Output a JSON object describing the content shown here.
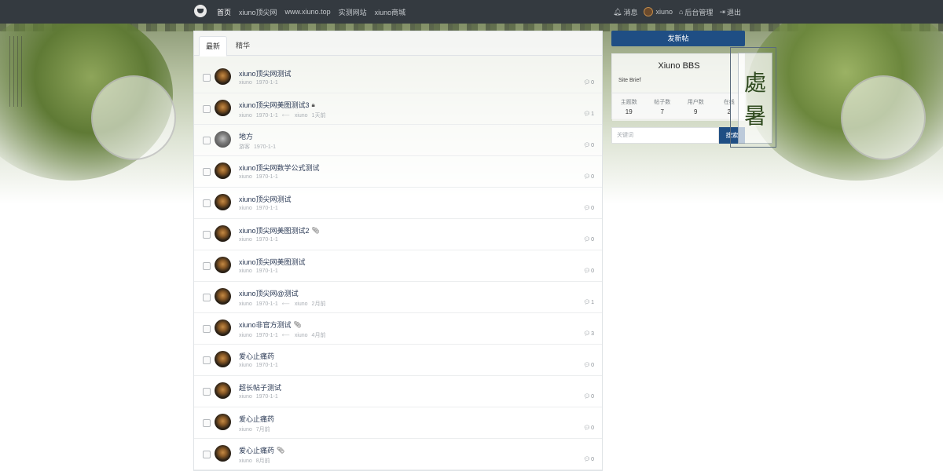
{
  "navbar": {
    "links": [
      "首页",
      "xiuno顶尖网",
      "www.xiuno.top",
      "实测网站",
      "xiuno商城"
    ],
    "messages_label": "消息",
    "username": "xiuno",
    "admin_label": "后台管理",
    "logout_label": "退出"
  },
  "tabs": [
    "最新",
    "精华"
  ],
  "threads": [
    {
      "title": "xiuno顶尖网测试",
      "author": "xiuno",
      "date": "1970-1-1",
      "last_user": "",
      "last_time": "",
      "replies": "0",
      "icon": "",
      "avatar": "xiuno"
    },
    {
      "title": "xiuno顶尖网美图测试3",
      "author": "xiuno",
      "date": "1970-1-1",
      "last_user": "xiuno",
      "last_time": "1天前",
      "replies": "1",
      "icon": "lock",
      "avatar": "xiuno"
    },
    {
      "title": "地方",
      "author": "游客",
      "date": "1970-1-1",
      "last_user": "",
      "last_time": "",
      "replies": "0",
      "icon": "",
      "avatar": "guest"
    },
    {
      "title": "xiuno顶尖网数学公式测试",
      "author": "xiuno",
      "date": "1970-1-1",
      "last_user": "",
      "last_time": "",
      "replies": "0",
      "icon": "",
      "avatar": "xiuno"
    },
    {
      "title": "xiuno顶尖网测试",
      "author": "xiuno",
      "date": "1970-1-1",
      "last_user": "",
      "last_time": "",
      "replies": "0",
      "icon": "",
      "avatar": "xiuno"
    },
    {
      "title": "xiuno顶尖网美图测试2",
      "author": "xiuno",
      "date": "1970-1-1",
      "last_user": "",
      "last_time": "",
      "replies": "0",
      "icon": "paperclip",
      "avatar": "xiuno"
    },
    {
      "title": "xiuno顶尖网美图测试",
      "author": "xiuno",
      "date": "1970-1-1",
      "last_user": "",
      "last_time": "",
      "replies": "0",
      "icon": "",
      "avatar": "xiuno"
    },
    {
      "title": "xiuno顶尖网@测试",
      "author": "xiuno",
      "date": "1970-1-1",
      "last_user": "xiuno",
      "last_time": "2月前",
      "replies": "1",
      "icon": "",
      "avatar": "xiuno"
    },
    {
      "title": "xiuno非官方测试",
      "author": "xiuno",
      "date": "1970-1-1",
      "last_user": "xiuno",
      "last_time": "4月前",
      "replies": "3",
      "icon": "paperclip",
      "avatar": "xiuno"
    },
    {
      "title": "爱心止痛药",
      "author": "xiuno",
      "date": "1970-1-1",
      "last_user": "",
      "last_time": "",
      "replies": "0",
      "icon": "",
      "avatar": "xiuno"
    },
    {
      "title": "超长帖子测试",
      "author": "xiuno",
      "date": "1970-1-1",
      "last_user": "",
      "last_time": "",
      "replies": "0",
      "icon": "",
      "avatar": "xiuno"
    },
    {
      "title": "爱心止痛药",
      "author": "xiuno",
      "date": "7月前",
      "last_user": "",
      "last_time": "",
      "replies": "0",
      "icon": "",
      "avatar": "xiuno"
    },
    {
      "title": "爱心止痛药",
      "author": "xiuno",
      "date": "8月前",
      "last_user": "",
      "last_time": "",
      "replies": "0",
      "icon": "paperclip",
      "avatar": "xiuno"
    }
  ],
  "sidebar": {
    "new_thread_label": "发新帖",
    "site_name": "Xiuno BBS",
    "site_brief": "Site Brief",
    "stats": [
      {
        "label": "主题数",
        "value": "19"
      },
      {
        "label": "帖子数",
        "value": "7"
      },
      {
        "label": "用户数",
        "value": "9"
      },
      {
        "label": "在线",
        "value": "2"
      }
    ],
    "search_placeholder": "关键词",
    "search_button": "搜索"
  },
  "decor": {
    "calligraphy": [
      "處",
      "暑"
    ]
  },
  "colors": {
    "navbar": "#343a40",
    "primary": "#1f4e84",
    "title": "#2b3a55"
  }
}
